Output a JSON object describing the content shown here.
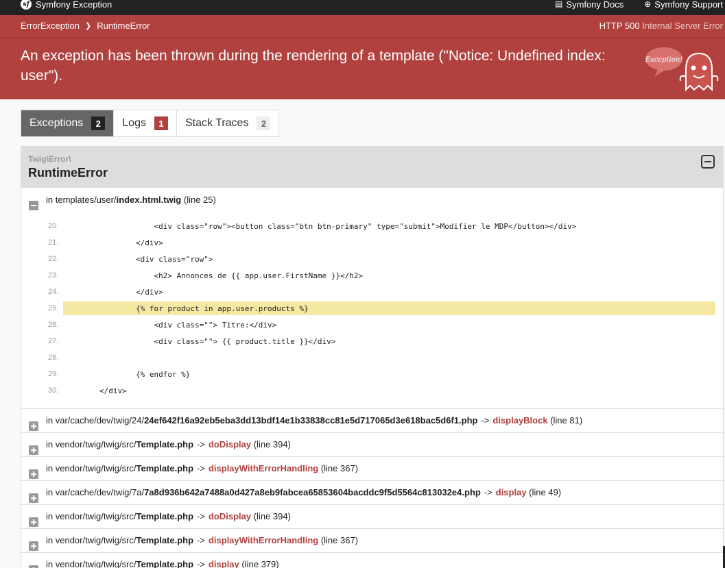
{
  "topbar": {
    "brand": "Symfony Exception",
    "docs": "Symfony Docs",
    "support": "Symfony Support"
  },
  "header": {
    "crumb_1": "ErrorException",
    "crumb_2": "RuntimeError",
    "status_code": "HTTP 500",
    "status_text": "Internal Server Error",
    "message": "An exception has been thrown during the rendering of a template (\"Notice: Undefined index: user\").",
    "ghost_text": "Exception!"
  },
  "tabs": [
    {
      "label": "Exceptions",
      "count": "2"
    },
    {
      "label": "Logs",
      "count": "1"
    },
    {
      "label": "Stack Traces",
      "count": "2"
    }
  ],
  "exception": {
    "namespace": "Twig\\Error\\",
    "class": "RuntimeError"
  },
  "first_trace": {
    "prefix": "in templates/user/",
    "file": "index.html.twig",
    "line_info": "(line 25)"
  },
  "code_lines": [
    {
      "num": "20.",
      "src": "                    <div class=\"row\"><button class=\"btn btn-primary\" type=\"submit\">Modifier le MDP</button></div>"
    },
    {
      "num": "21.",
      "src": "                </div>"
    },
    {
      "num": "22.",
      "src": "                <div class=\"row\">"
    },
    {
      "num": "23.",
      "src": "                    <h2> Annonces de {{ app.user.FirstName }}</h2>"
    },
    {
      "num": "24.",
      "src": "                </div>"
    },
    {
      "num": "25.",
      "src": "                {% for product in app.user.products %}"
    },
    {
      "num": "26.",
      "src": "                    <div class=\"\"> Titre:</div>"
    },
    {
      "num": "27.",
      "src": "                    <div class=\"\"> {{ product.title }}</div>"
    },
    {
      "num": "28.",
      "src": ""
    },
    {
      "num": "29.",
      "src": "                {% endfor %}"
    },
    {
      "num": "30.",
      "src": "        </div>"
    }
  ],
  "traces": [
    {
      "prefix": "in var/cache/dev/twig/24/",
      "file": "24ef642f16a92eb5eba3dd13bdf14e1b33838cc81e5d717065d3e618bac5d6f1.php",
      "arrow": "->",
      "fn": "displayBlock",
      "line_info": "(line 81)"
    },
    {
      "prefix": "in vendor/twig/twig/src/",
      "file": "Template.php",
      "arrow": "->",
      "fn": "doDisplay",
      "line_info": "(line 394)"
    },
    {
      "prefix": "in vendor/twig/twig/src/",
      "file": "Template.php",
      "arrow": "->",
      "fn": "displayWithErrorHandling",
      "line_info": "(line 367)"
    },
    {
      "prefix": "in var/cache/dev/twig/7a/",
      "file": "7a8d936b642a7488a0d427a8eb9fabcea65853604bacddc9f5d5564c813032e4.php",
      "arrow": "->",
      "fn": "display",
      "line_info": "(line 49)"
    },
    {
      "prefix": "in vendor/twig/twig/src/",
      "file": "Template.php",
      "arrow": "->",
      "fn": "doDisplay",
      "line_info": "(line 394)"
    },
    {
      "prefix": "in vendor/twig/twig/src/",
      "file": "Template.php",
      "arrow": "->",
      "fn": "displayWithErrorHandling",
      "line_info": "(line 367)"
    },
    {
      "prefix": "in vendor/twig/twig/src/",
      "file": "Template.php",
      "arrow": "->",
      "fn": "display",
      "line_info": "(line 379)"
    }
  ],
  "highlight_line": "25.",
  "colors": {
    "accent": "#b0413e",
    "highlight": "#f5e8a3",
    "topbar": "#222222"
  }
}
